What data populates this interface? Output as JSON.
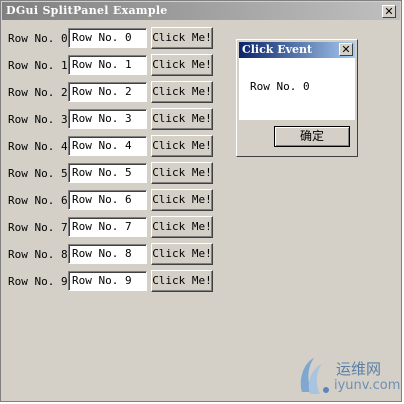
{
  "window": {
    "title": "DGui SplitPanel Example",
    "close_glyph": "✕",
    "icon_names": {
      "close": "close-icon"
    }
  },
  "rows": [
    {
      "label": "Row No. 0",
      "value": "Row No. 0",
      "button": "Click Me!"
    },
    {
      "label": "Row No. 1",
      "value": "Row No. 1",
      "button": "Click Me!"
    },
    {
      "label": "Row No. 2",
      "value": "Row No. 2",
      "button": "Click Me!"
    },
    {
      "label": "Row No. 3",
      "value": "Row No. 3",
      "button": "Click Me!"
    },
    {
      "label": "Row No. 4",
      "value": "Row No. 4",
      "button": "Click Me!"
    },
    {
      "label": "Row No. 5",
      "value": "Row No. 5",
      "button": "Click Me!"
    },
    {
      "label": "Row No. 6",
      "value": "Row No. 6",
      "button": "Click Me!"
    },
    {
      "label": "Row No. 7",
      "value": "Row No. 7",
      "button": "Click Me!"
    },
    {
      "label": "Row No. 8",
      "value": "Row No. 8",
      "button": "Click Me!"
    },
    {
      "label": "Row No. 9",
      "value": "Row No. 9",
      "button": "Click Me!"
    }
  ],
  "dialog": {
    "title": "Click Event",
    "message": "Row No. 0",
    "ok_label": "确定",
    "close_glyph": "✕"
  },
  "watermark": {
    "text_cn": "运维网",
    "text_url": "iyunv.com"
  },
  "colors": {
    "window_bg": "#d4d0c8",
    "inactive_title": "#808080",
    "active_title": "#0a246a"
  }
}
